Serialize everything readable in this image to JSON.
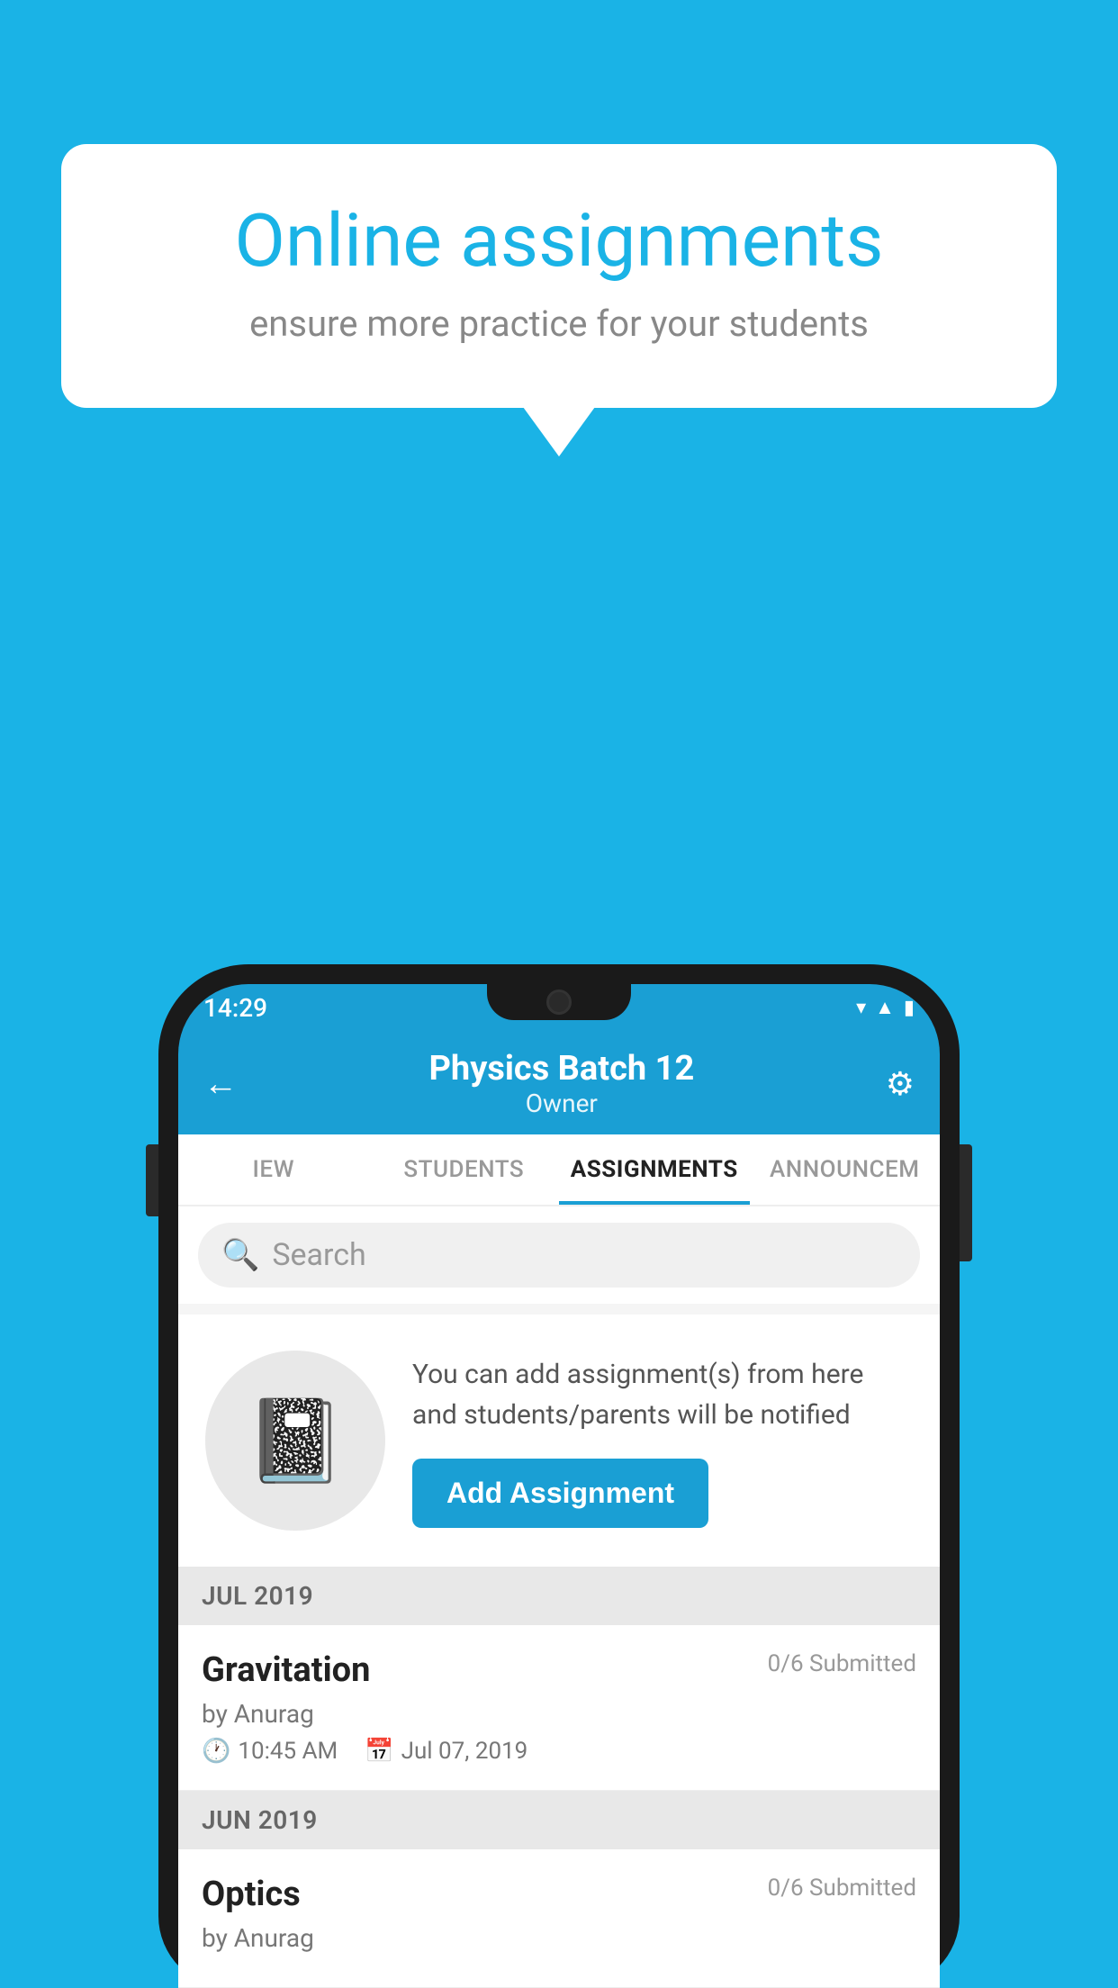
{
  "background_color": "#1ab3e6",
  "bubble": {
    "title": "Online assignments",
    "subtitle": "ensure more practice for your students"
  },
  "status_bar": {
    "time": "14:29",
    "icons": [
      "wifi",
      "signal",
      "battery"
    ]
  },
  "header": {
    "title": "Physics Batch 12",
    "subtitle": "Owner",
    "back_label": "←",
    "settings_label": "⚙"
  },
  "tabs": [
    {
      "label": "IEW",
      "active": false
    },
    {
      "label": "STUDENTS",
      "active": false
    },
    {
      "label": "ASSIGNMENTS",
      "active": true
    },
    {
      "label": "ANNOUNCEM",
      "active": false
    }
  ],
  "search": {
    "placeholder": "Search"
  },
  "empty_state": {
    "info_text": "You can add assignment(s) from here and students/parents will be notified",
    "button_label": "Add Assignment"
  },
  "sections": [
    {
      "month": "JUL 2019",
      "assignments": [
        {
          "name": "Gravitation",
          "submitted": "0/6 Submitted",
          "by": "by Anurag",
          "time": "10:45 AM",
          "date": "Jul 07, 2019"
        }
      ]
    },
    {
      "month": "JUN 2019",
      "assignments": [
        {
          "name": "Optics",
          "submitted": "0/6 Submitted",
          "by": "by Anurag",
          "time": "",
          "date": ""
        }
      ]
    }
  ]
}
